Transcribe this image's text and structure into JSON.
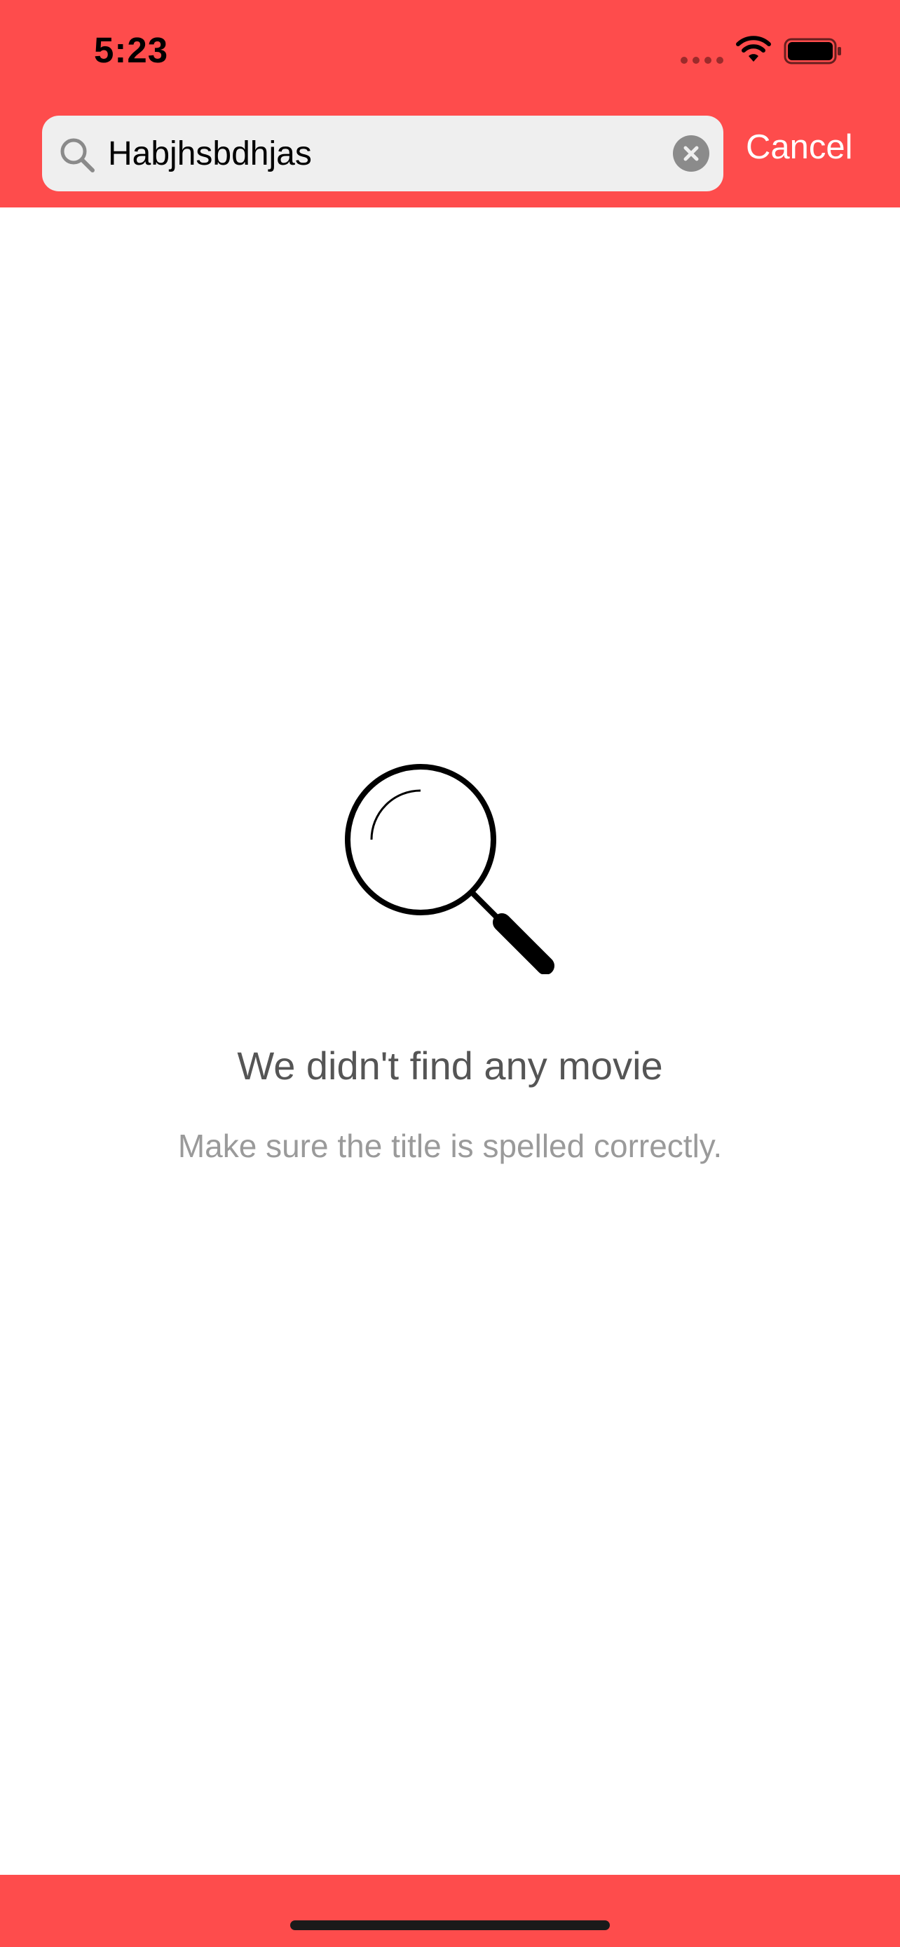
{
  "status_bar": {
    "time": "5:23",
    "signal_icon": "signal-dots-icon",
    "wifi_icon": "wifi-icon",
    "battery_icon": "battery-icon"
  },
  "search": {
    "icon": "search-icon",
    "value": "Habjhsbdhjas",
    "clear_icon": "clear-icon",
    "cancel_label": "Cancel"
  },
  "empty_state": {
    "icon": "magnifying-glass-icon",
    "title": "We didn't find any movie",
    "subtitle": "Make sure the title is spelled correctly."
  },
  "colors": {
    "accent": "#fe4c4c",
    "search_field": "#efefef",
    "title_text": "#555555",
    "subtitle_text": "#9a9a9a"
  }
}
